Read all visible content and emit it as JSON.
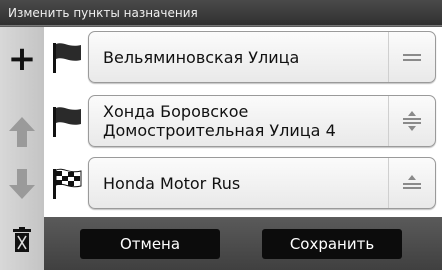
{
  "header": {
    "title": "Изменить пункты назначения"
  },
  "sidebar": {
    "add_label": "+",
    "items": [
      {
        "name": "add-destination-button",
        "icon": "plus-icon"
      },
      {
        "name": "move-up-button",
        "icon": "arrow-up-icon"
      },
      {
        "name": "move-down-button",
        "icon": "arrow-down-icon"
      },
      {
        "name": "delete-button",
        "icon": "trash-icon"
      }
    ]
  },
  "destinations": [
    {
      "label": "Вельяминовская Улица",
      "flag_icon": "flag-icon"
    },
    {
      "label": "Хонда Боровское Домостроительная Улица 4",
      "flag_icon": "flag-icon"
    },
    {
      "label": "Honda Motor Rus",
      "flag_icon": "checkered-flag-icon"
    }
  ],
  "footer": {
    "cancel_label": "Отмена",
    "save_label": "Сохранить"
  },
  "colors": {
    "title_bg": "#3a3a3a",
    "sidebar_bg": "#cccccc",
    "button_bg": "#0c0c0c",
    "card_bg": "#f2f2f2"
  }
}
